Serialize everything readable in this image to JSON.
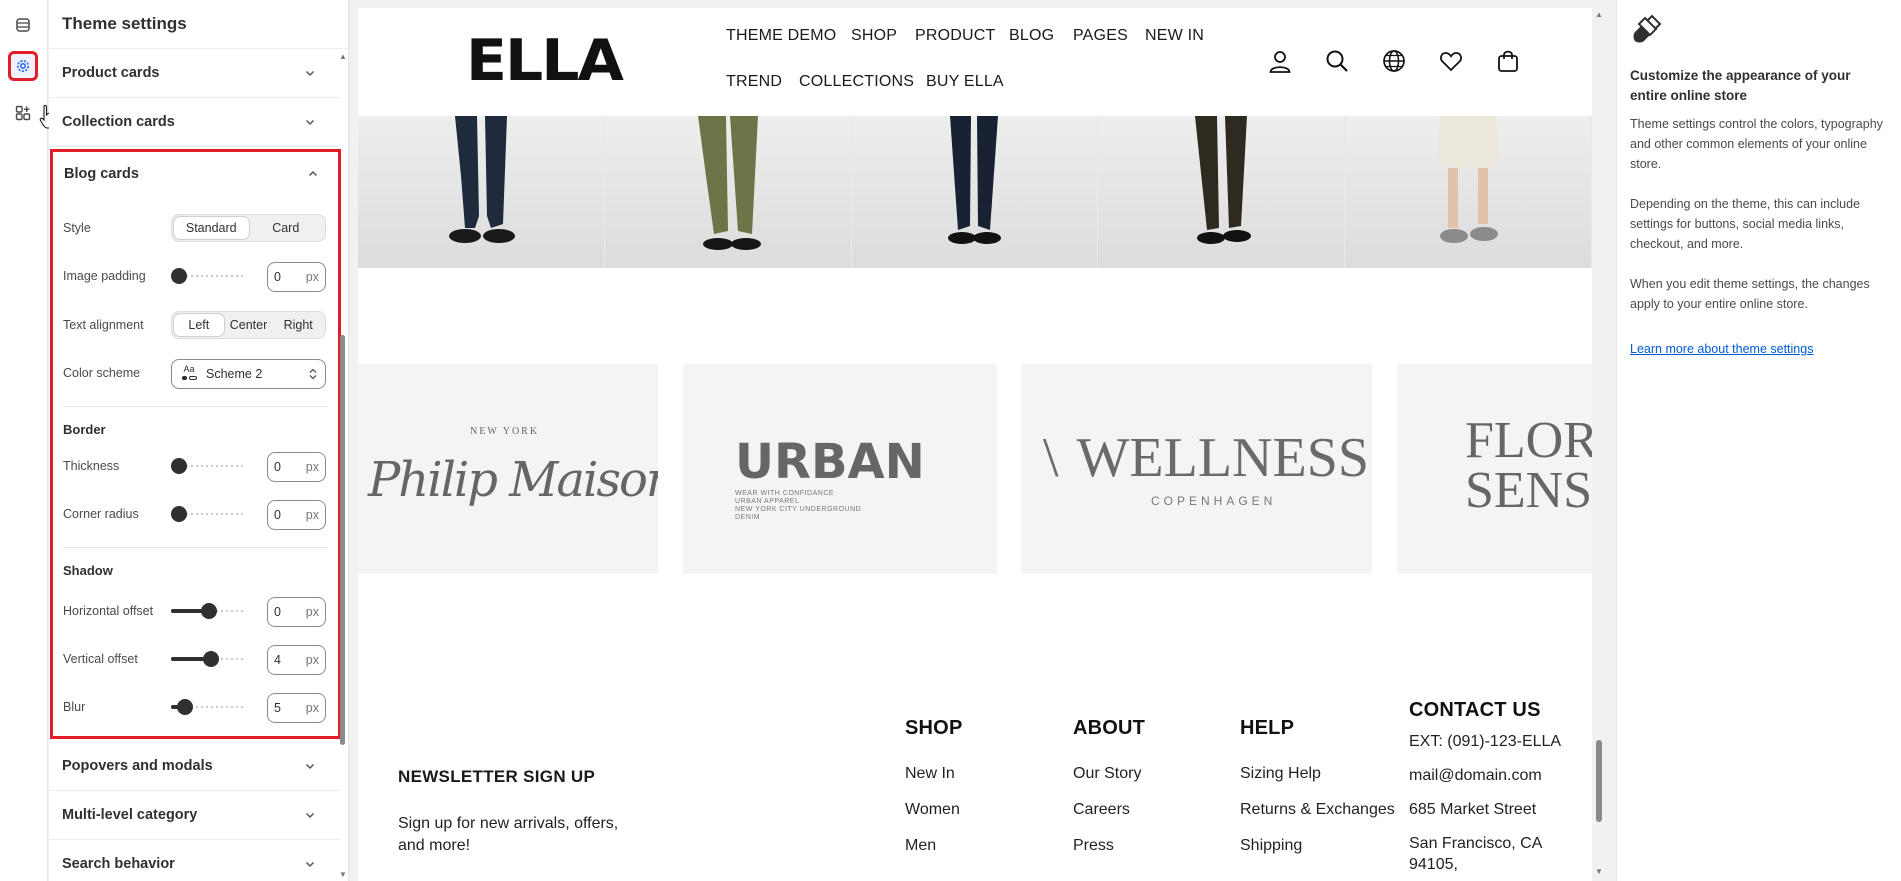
{
  "panel": {
    "title": "Theme settings",
    "sections_above": [
      {
        "label": "Product cards"
      },
      {
        "label": "Collection cards"
      }
    ],
    "blog_cards": {
      "label": "Blog cards",
      "style": {
        "label": "Style",
        "options": [
          "Standard",
          "Card"
        ],
        "selected": "Standard"
      },
      "image_padding": {
        "label": "Image padding",
        "value": "0",
        "unit": "px",
        "level": 0
      },
      "text_alignment": {
        "label": "Text alignment",
        "options": [
          "Left",
          "Center",
          "Right"
        ],
        "selected": "Left"
      },
      "color_scheme": {
        "label": "Color scheme",
        "value": "Scheme 2",
        "icon_text": "Aa"
      },
      "border": {
        "heading": "Border",
        "thickness": {
          "label": "Thickness",
          "value": "0",
          "unit": "px",
          "level": 0
        },
        "corner_radius": {
          "label": "Corner radius",
          "value": "0",
          "unit": "px",
          "level": 0
        }
      },
      "shadow": {
        "heading": "Shadow",
        "horizontal_offset": {
          "label": "Horizontal offset",
          "value": "0",
          "unit": "px",
          "level": 0.5
        },
        "vertical_offset": {
          "label": "Vertical offset",
          "value": "4",
          "unit": "px",
          "level": 0.54
        },
        "blur": {
          "label": "Blur",
          "value": "5",
          "unit": "px",
          "level": 0.1
        }
      }
    },
    "sections_below": [
      {
        "label": "Popovers and modals"
      },
      {
        "label": "Multi-level category"
      },
      {
        "label": "Search behavior"
      }
    ]
  },
  "rail": {
    "icons": [
      "sections-icon",
      "gear-icon",
      "apps-icon"
    ],
    "active": "gear-icon"
  },
  "preview": {
    "logo": "ELLA",
    "nav_row1": [
      "THEME DEMO",
      "SHOP",
      "PRODUCT",
      "BLOG",
      "PAGES",
      "NEW IN"
    ],
    "nav_row2": [
      "TREND",
      "COLLECTIONS",
      "BUY ELLA"
    ],
    "header_icons": [
      "account-icon",
      "search-icon",
      "globe-icon",
      "wishlist-icon",
      "cart-icon"
    ],
    "brands": [
      {
        "small": "NEW YORK",
        "name": "Philip Maison"
      },
      {
        "name": "URBAN",
        "tagline": [
          "WEAR WITH CONFIDANCE",
          "URBAN APPAREL",
          "NEW YORK CITY UNDERGROUND",
          "DENIM"
        ]
      },
      {
        "name": "WELLNESS",
        "sub": "COPENHAGEN"
      },
      {
        "name": [
          "FLOR",
          "SENS"
        ]
      }
    ],
    "newsletter": {
      "heading": "NEWSLETTER SIGN UP",
      "text": "Sign up for new arrivals, offers, and more!"
    },
    "footer": {
      "shop": {
        "heading": "SHOP",
        "links": [
          "New In",
          "Women",
          "Men"
        ]
      },
      "about": {
        "heading": "ABOUT",
        "links": [
          "Our Story",
          "Careers",
          "Press"
        ]
      },
      "help": {
        "heading": "HELP",
        "links": [
          "Sizing Help",
          "Returns & Exchanges",
          "Shipping"
        ]
      },
      "contact": {
        "heading": "CONTACT US",
        "lines": [
          "EXT: (091)-123-ELLA",
          "mail@domain.com",
          "685 Market Street",
          "San Francisco, CA",
          "94105,"
        ]
      }
    }
  },
  "help": {
    "title": "Customize the appearance of your entire online store",
    "paragraphs": [
      "Theme settings control the colors, typography and other common elements of your online store.",
      "Depending on the theme, this can include settings for buttons, social media links, checkout, and more.",
      "When you edit theme settings, the changes apply to your entire online store."
    ],
    "link": "Learn more about theme settings"
  },
  "colors": {
    "highlight": "#e11d27",
    "accent": "#005bd3",
    "slider": "#303030"
  }
}
